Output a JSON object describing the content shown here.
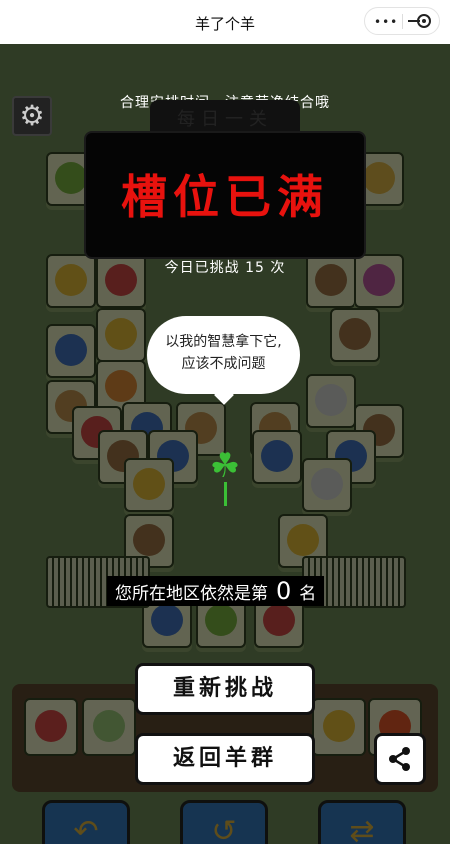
{
  "topbar": {
    "title": "羊了个羊"
  },
  "overlay": {
    "tip": "合理安排时间，注意劳逸结合哦",
    "daily_tab": "每日一关",
    "headline": "槽位已满",
    "attempts": "今日已挑战 15 次",
    "bubble_line1": "以我的智慧拿下它,",
    "bubble_line2": "应该不成问题",
    "region_prefix": "您所在地区依然是第",
    "region_rank": "0",
    "region_suffix": "名",
    "retry_label": "重新挑战",
    "back_label": "返回羊群"
  },
  "icons": {
    "settings": "gear-icon",
    "share": "share-icon",
    "clover": "four-leaf-clover-icon"
  },
  "colors": {
    "headline": "#e8120e",
    "board": "#6d8a55",
    "tile": "#f2f4c8",
    "tool": "#2b78c9"
  }
}
